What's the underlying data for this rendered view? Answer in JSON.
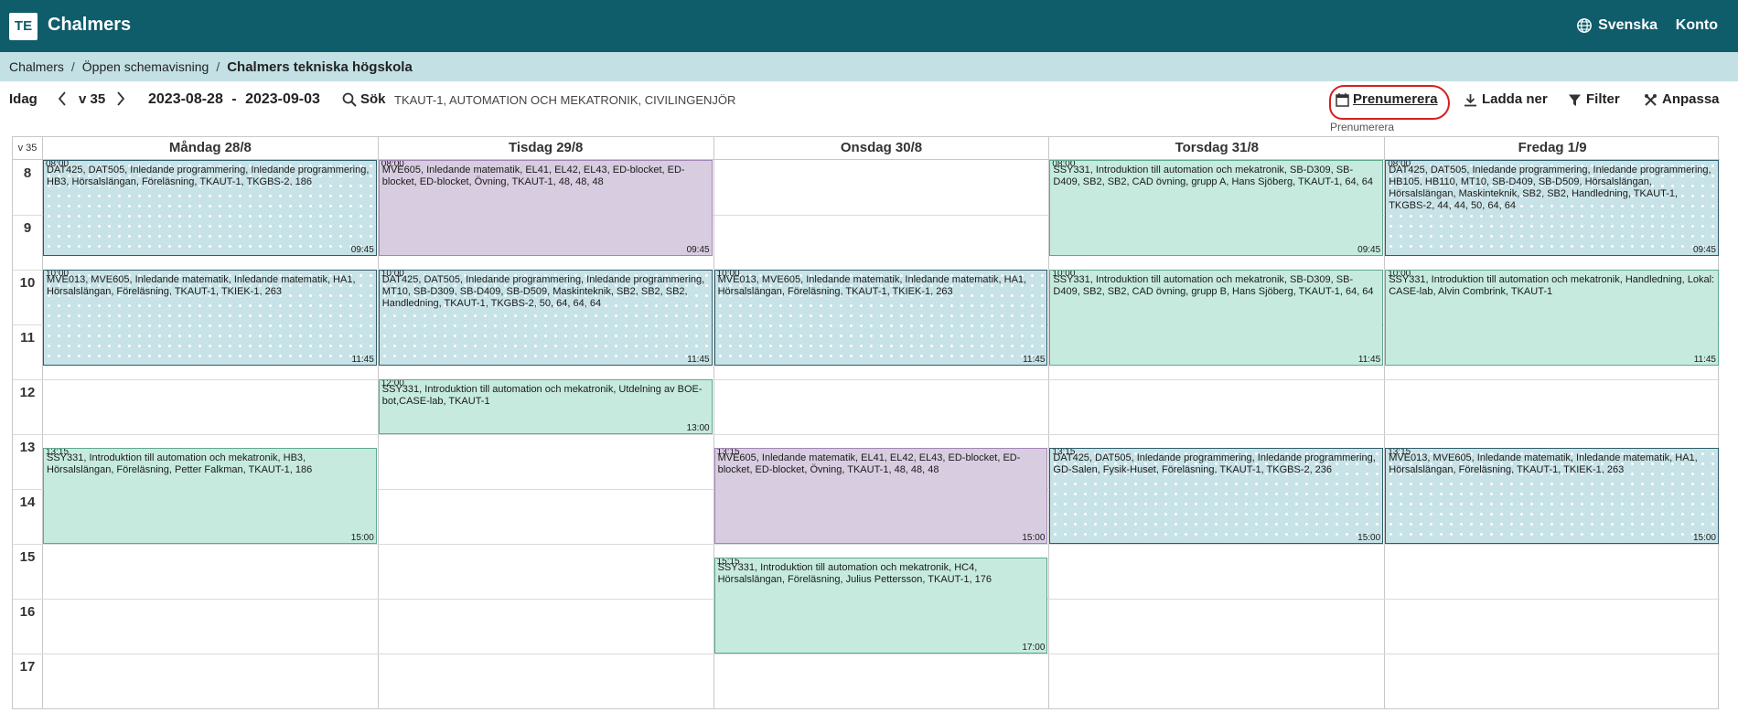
{
  "header": {
    "logo": "TE",
    "app_name": "Chalmers",
    "language": "Svenska",
    "account": "Konto"
  },
  "breadcrumb": [
    "Chalmers",
    "Öppen schemavisning",
    "Chalmers tekniska högskola"
  ],
  "toolbar": {
    "today": "Idag",
    "week": "v 35",
    "date_from": "2023-08-28",
    "date_sep": "-",
    "date_to": "2023-09-03",
    "search_label": "Sök",
    "search_query": "TKAUT-1, AUTOMATION OCH MEKATRONIK, CIVILINGENJÖR",
    "subscribe": "Prenumerera",
    "subscribe_tooltip": "Prenumerera",
    "download": "Ladda ner",
    "filter": "Filter",
    "customize": "Anpassa"
  },
  "calendar": {
    "week_label": "v 35",
    "days": [
      "Måndag 28/8",
      "Tisdag 29/8",
      "Onsdag 30/8",
      "Torsdag 31/8",
      "Fredag 1/9"
    ],
    "hours": [
      "8",
      "9",
      "10",
      "11",
      "12",
      "13",
      "14",
      "15",
      "16",
      "17"
    ],
    "colors": {
      "lecture_dots": "#c8e3e7",
      "exercise_purple": "#d8cde0",
      "lab_green": "#c6ebde",
      "header_bar": "#0f5c6b",
      "breadcrumb_bar": "#c3e1e5",
      "highlight_circle": "#d4201f"
    },
    "events": [
      {
        "day": 0,
        "start": "08:00",
        "end": "09:45",
        "style": "dots",
        "text": "DAT425, DAT505, Inledande programmering, Inledande programmering, HB3, Hörsalslängan, Föreläsning, TKAUT-1, TKGBS-2, 186"
      },
      {
        "day": 0,
        "start": "10:00",
        "end": "11:45",
        "style": "dots",
        "text": "MVE013, MVE605, Inledande matematik, Inledande matematik, HA1, Hörsalslängan, Föreläsning, TKAUT-1, TKIEK-1, 263"
      },
      {
        "day": 0,
        "start": "13:15",
        "end": "15:00",
        "style": "green",
        "text": "SSY331, Introduktion till automation och mekatronik, HB3, Hörsalslängan, Föreläsning, Petter Falkman, TKAUT-1, 186"
      },
      {
        "day": 1,
        "start": "08:00",
        "end": "09:45",
        "style": "purple",
        "text": "MVE605, Inledande matematik, EL41, EL42, EL43, ED-blocket, ED-blocket, ED-blocket, Övning, TKAUT-1, 48, 48, 48"
      },
      {
        "day": 1,
        "start": "10:00",
        "end": "11:45",
        "style": "dots",
        "text": "DAT425, DAT505, Inledande programmering, Inledande programmering, MT10, SB-D309, SB-D409, SB-D509, Maskinteknik, SB2, SB2, SB2, Handledning, TKAUT-1, TKGBS-2, 50, 64, 64, 64"
      },
      {
        "day": 1,
        "start": "12:00",
        "end": "13:00",
        "style": "green",
        "text": "SSY331, Introduktion till automation och mekatronik, Utdelning av BOE-bot,CASE-lab, TKAUT-1"
      },
      {
        "day": 2,
        "start": "10:00",
        "end": "11:45",
        "style": "dots",
        "text": "MVE013, MVE605, Inledande matematik, Inledande matematik, HA1, Hörsalslängan, Föreläsning, TKAUT-1, TKIEK-1, 263"
      },
      {
        "day": 2,
        "start": "13:15",
        "end": "15:00",
        "style": "purple",
        "text": "MVE605, Inledande matematik, EL41, EL42, EL43, ED-blocket, ED-blocket, ED-blocket, Övning, TKAUT-1, 48, 48, 48"
      },
      {
        "day": 2,
        "start": "15:15",
        "end": "17:00",
        "style": "green",
        "text": "SSY331, Introduktion till automation och mekatronik, HC4, Hörsalslängan, Föreläsning, Julius Pettersson, TKAUT-1, 176"
      },
      {
        "day": 3,
        "start": "08:00",
        "end": "09:45",
        "style": "green",
        "text": "SSY331, Introduktion till automation och mekatronik, SB-D309, SB-D409, SB2, SB2, CAD övning, grupp A, Hans Sjöberg, TKAUT-1, 64, 64"
      },
      {
        "day": 3,
        "start": "10:00",
        "end": "11:45",
        "style": "green",
        "text": "SSY331, Introduktion till automation och mekatronik, SB-D309, SB-D409, SB2, SB2, CAD övning, grupp B, Hans Sjöberg, TKAUT-1, 64, 64"
      },
      {
        "day": 3,
        "start": "13:15",
        "end": "15:00",
        "style": "dots",
        "text": "DAT425, DAT505, Inledande programmering, Inledande programmering, GD-Salen, Fysik-Huset, Föreläsning, TKAUT-1, TKGBS-2, 236"
      },
      {
        "day": 4,
        "start": "08:00",
        "end": "09:45",
        "style": "dots",
        "text": "DAT425, DAT505, Inledande programmering, Inledande programmering, HB105, HB110, MT10, SB-D409, SB-D509, Hörsalslängan, Hörsalslängan, Maskinteknik, SB2, SB2, Handledning, TKAUT-1, TKGBS-2, 44, 44, 50, 64, 64"
      },
      {
        "day": 4,
        "start": "10:00",
        "end": "11:45",
        "style": "green",
        "text": "SSY331, Introduktion till automation och mekatronik, Handledning, Lokal: CASE-lab, Alvin Combrink, TKAUT-1"
      },
      {
        "day": 4,
        "start": "13:15",
        "end": "15:00",
        "style": "dots",
        "text": "MVE013, MVE605, Inledande matematik, Inledande matematik, HA1, Hörsalslängan, Föreläsning, TKAUT-1, TKIEK-1, 263"
      }
    ]
  }
}
